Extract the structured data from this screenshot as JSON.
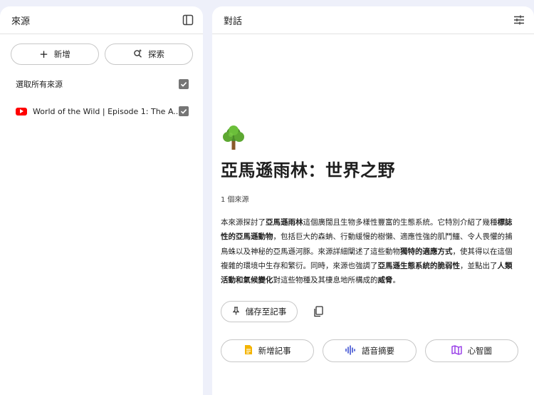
{
  "sources_panel": {
    "title": "來源",
    "add_label": "新增",
    "explore_label": "探索",
    "select_all_label": "選取所有來源",
    "sources": [
      {
        "title": "World of the Wild | Episode 1: The A...",
        "type": "youtube"
      }
    ]
  },
  "chat_panel": {
    "title": "對話",
    "notebook_title": "亞馬遜雨林：世界之野",
    "source_count": "1 個來源",
    "summary": {
      "s1": "本來源探討了",
      "b1": "亞馬遜雨林",
      "s2": "這個廣闊且生物多樣性豐富的生態系統。它特別介紹了幾種",
      "b2": "標誌性的亞馬遜動物",
      "s3": "，包括巨大的森蚺、行動緩慢的樹懶、適應性強的肌鬥鱷、令人畏懼的捕鳥蛛以及神秘的亞馬遜河豚。來源詳細闡述了這些動物",
      "b3": "獨特的適應方式",
      "s4": "，使其得以在這個複雜的環境中生存和繁衍。同時，來源也強調了",
      "b4": "亞馬遜生態系統的脆弱性",
      "s5": "，並點出了",
      "b5": "人類活動和氣候變化",
      "s6": "對這些物種及其棲息地所構成的",
      "b6": "威脅",
      "s7": "。"
    },
    "save_note_label": "儲存至記事",
    "add_note_label": "新增記事",
    "audio_overview_label": "語音摘要",
    "mind_map_label": "心智圖"
  },
  "colors": {
    "background": "#eef0fa",
    "youtube_red": "#ff0000",
    "note_yellow": "#f4b400",
    "audio_blue": "#3c4fd1",
    "mindmap_purple": "#9334e6"
  }
}
